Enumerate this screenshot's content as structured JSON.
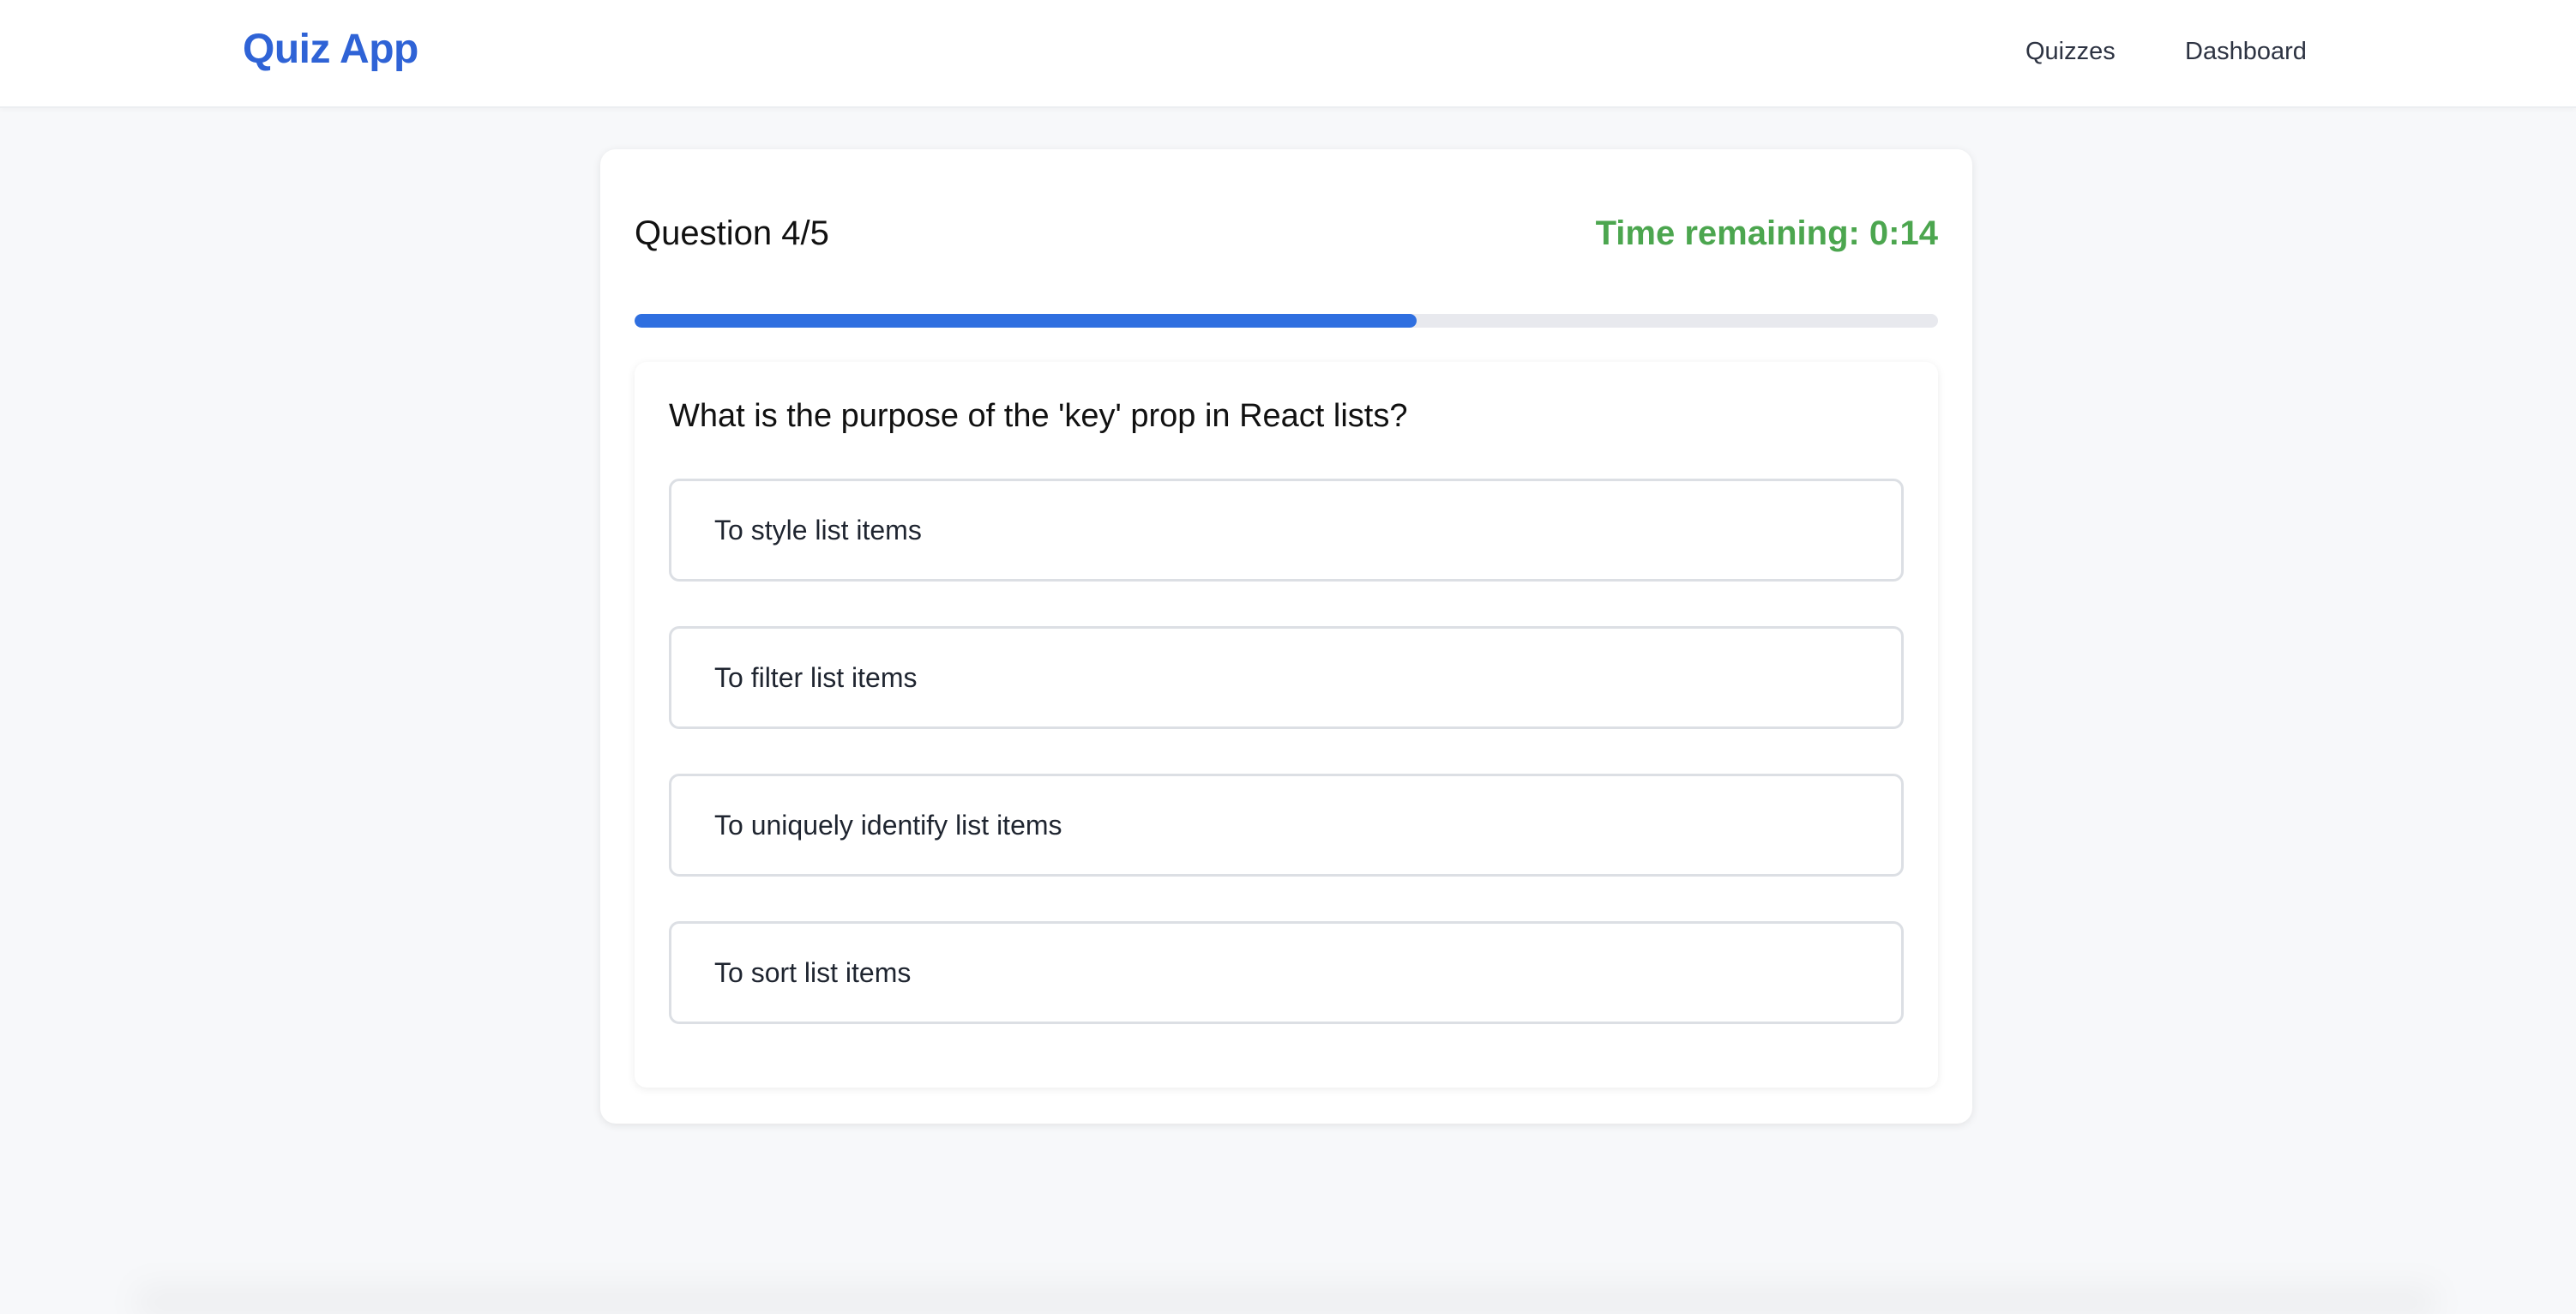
{
  "header": {
    "brand": "Quiz App",
    "nav": [
      {
        "label": "Quizzes"
      },
      {
        "label": "Dashboard"
      }
    ]
  },
  "quiz": {
    "question_counter": "Question 4/5",
    "timer_text": "Time remaining: 0:14",
    "progress_fraction": 0.6,
    "question": "What is the purpose of the 'key' prop in React lists?",
    "options": [
      {
        "label": "To style list items"
      },
      {
        "label": "To filter list items"
      },
      {
        "label": "To uniquely identify list items"
      },
      {
        "label": "To sort list items"
      }
    ]
  },
  "colors": {
    "brand": "#2f63d6",
    "timer": "#4ca64f",
    "progress": "#2f6fe0",
    "progress_track": "#e8e9ee"
  }
}
